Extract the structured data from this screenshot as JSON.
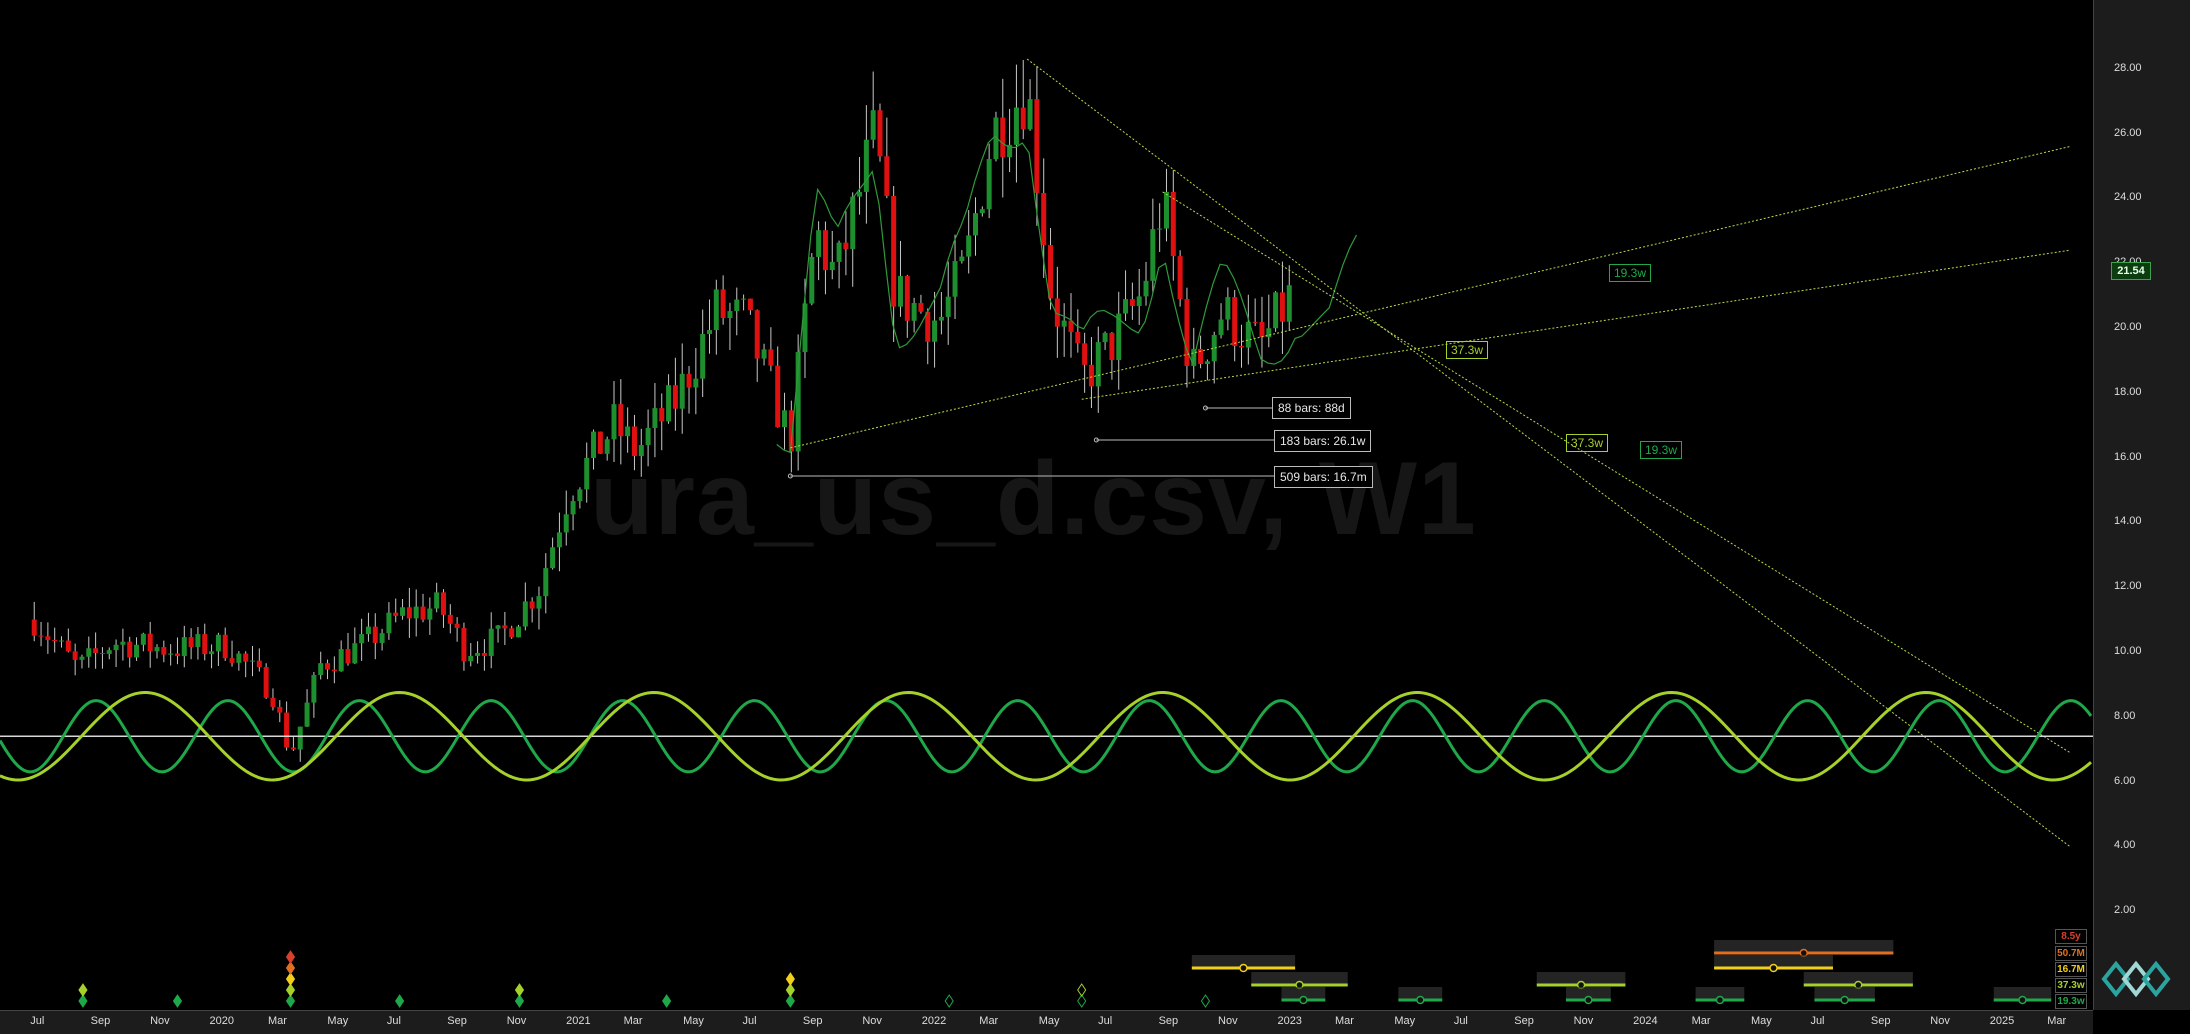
{
  "watermark": "ura_us_d.csv, W1",
  "price_scale": {
    "ticks": [
      "28.00",
      "26.00",
      "24.00",
      "22.00",
      "20.00",
      "18.00",
      "16.00",
      "14.00",
      "12.00",
      "10.00",
      "8.00",
      "6.00",
      "4.00",
      "2.00"
    ],
    "last_price": "21.54"
  },
  "time_scale": {
    "ticks": [
      "Jul",
      "Sep",
      "Nov",
      "2020",
      "Mar",
      "May",
      "Jul",
      "Sep",
      "Nov",
      "2021",
      "Mar",
      "May",
      "Jul",
      "Sep",
      "Nov",
      "2022",
      "Mar",
      "May",
      "Jul",
      "Sep",
      "Nov",
      "2023",
      "Mar",
      "May",
      "Jul",
      "Sep",
      "Nov",
      "2024",
      "Mar",
      "May",
      "Jul",
      "Sep",
      "Nov",
      "2025",
      "Mar"
    ]
  },
  "annotations": {
    "bars_labels": [
      "88 bars: 88d",
      "183 bars: 26.1w",
      "509 bars: 16.7m"
    ],
    "projection_labels": [
      "19.3w",
      "37.3w",
      "37.3w",
      "19.3w"
    ]
  },
  "cycle_tags": [
    "8.5y",
    "50.7M",
    "16.7M",
    "37.3w",
    "19.3w"
  ],
  "colors": {
    "up": "#1e8f2e",
    "down": "#e01010",
    "wave_fast": "#1fa84a",
    "wave_slow": "#a6d02a",
    "trend": "#9acd32",
    "midline": "#d8d8d8",
    "tag_red": "#d9402b",
    "tag_orange": "#e07020",
    "tag_yellow": "#f2d019",
    "tag_lime": "#a6d02a",
    "tag_green": "#1fa84a"
  },
  "chart_data": {
    "type": "candlestick",
    "timeframe": "weekly",
    "x_range": [
      "2019-06",
      "2025-03"
    ],
    "ylim": [
      0,
      30
    ],
    "price_path": [
      [
        "2019-07-01",
        11.0
      ],
      [
        "2019-08-15",
        9.5
      ],
      [
        "2019-09-20",
        10.3
      ],
      [
        "2019-11-15",
        10.1
      ],
      [
        "2020-01-15",
        10.2
      ],
      [
        "2020-03-01",
        8.8
      ],
      [
        "2020-03-20",
        6.8
      ],
      [
        "2020-04-20",
        9.6
      ],
      [
        "2020-06-01",
        10.2
      ],
      [
        "2020-07-15",
        11.2
      ],
      [
        "2020-08-20",
        11.4
      ],
      [
        "2020-09-15",
        10.1
      ],
      [
        "2020-10-20",
        10.4
      ],
      [
        "2020-11-30",
        12.0
      ],
      [
        "2020-12-31",
        15.0
      ],
      [
        "2021-02-15",
        17.0
      ],
      [
        "2021-03-10",
        16.2
      ],
      [
        "2021-04-20",
        17.8
      ],
      [
        "2021-05-31",
        20.5
      ],
      [
        "2021-06-30",
        20.2
      ],
      [
        "2021-08-15",
        16.5
      ],
      [
        "2021-09-10",
        23.0
      ],
      [
        "2021-10-01",
        21.5
      ],
      [
        "2021-11-10",
        26.0
      ],
      [
        "2021-12-01",
        21.0
      ],
      [
        "2022-01-15",
        20.2
      ],
      [
        "2022-02-10",
        21.8
      ],
      [
        "2022-03-10",
        26.0
      ],
      [
        "2022-04-15",
        27.5
      ],
      [
        "2022-05-10",
        21.0
      ],
      [
        "2022-06-10",
        18.4
      ],
      [
        "2022-07-10",
        19.5
      ],
      [
        "2022-08-10",
        21.0
      ],
      [
        "2022-09-01",
        24.0
      ],
      [
        "2022-10-01",
        18.6
      ],
      [
        "2022-11-01",
        20.5
      ],
      [
        "2022-12-10",
        19.4
      ],
      [
        "2023-01-15",
        21.2
      ]
    ],
    "projection_path": [
      [
        "2023-01-15",
        21.2
      ],
      [
        "2023-02-01",
        20.8
      ],
      [
        "2023-02-20",
        20.0
      ],
      [
        "2023-03-10",
        20.8
      ],
      [
        "2023-03-25",
        21.6
      ]
    ],
    "trendlines": [
      {
        "from": [
          "2021-08-15",
          16.3
        ],
        "to": [
          "2025-03-20",
          25.6
        ]
      },
      {
        "from": [
          "2022-06-10",
          17.8
        ],
        "to": [
          "2025-03-20",
          22.4
        ]
      },
      {
        "from": [
          "2022-04-15",
          28.3
        ],
        "to": [
          "2025-03-20",
          4.0
        ]
      },
      {
        "from": [
          "2022-09-01",
          24.2
        ],
        "to": [
          "2025-03-20",
          6.9
        ]
      }
    ],
    "measure_lines": [
      {
        "from": "2022-10-15",
        "to": "2023-01-15",
        "label": "88 bars: 88d"
      },
      {
        "from": "2022-06-25",
        "to": "2023-01-15",
        "label": "183 bars: 26.1w"
      },
      {
        "from": "2021-08-15",
        "to": "2023-01-15",
        "label": "509 bars: 16.7m"
      }
    ],
    "oscillator": {
      "midline": 7.4,
      "series": [
        {
          "name": "19.3w",
          "period_weeks": 19.3,
          "amplitude": 1.1
        },
        {
          "name": "37.3w",
          "period_weeks": 37.3,
          "amplitude": 1.35
        }
      ]
    },
    "cycle_markers": [
      {
        "date": "2019-08-20",
        "colors": [
          "tag_lime",
          "tag_green"
        ]
      },
      {
        "date": "2019-11-25",
        "colors": [
          "tag_green"
        ]
      },
      {
        "date": "2020-03-20",
        "colors": [
          "tag_red",
          "tag_orange",
          "tag_yellow",
          "tag_lime",
          "tag_green"
        ]
      },
      {
        "date": "2020-07-10",
        "colors": [
          "tag_green"
        ]
      },
      {
        "date": "2020-11-10",
        "colors": [
          "tag_lime",
          "tag_green"
        ]
      },
      {
        "date": "2021-04-10",
        "colors": [
          "tag_green"
        ]
      },
      {
        "date": "2021-08-15",
        "colors": [
          "tag_yellow",
          "tag_lime",
          "tag_green"
        ]
      },
      {
        "date": "2022-01-25",
        "colors": [
          "tag_green"
        ],
        "hollow": true
      },
      {
        "date": "2022-06-10",
        "colors": [
          "tag_lime",
          "tag_green"
        ],
        "hollow": true
      },
      {
        "date": "2022-10-15",
        "colors": [
          "tag_green"
        ],
        "hollow": true
      }
    ],
    "projection_windows": [
      {
        "from": "2022-12-01",
        "to": "2023-03-10",
        "color": "tag_lime"
      },
      {
        "from": "2023-01-01",
        "to": "2023-02-15",
        "color": "tag_green"
      },
      {
        "from": "2023-05-01",
        "to": "2023-06-15",
        "color": "tag_green"
      },
      {
        "from": "2023-09-20",
        "to": "2023-12-20",
        "color": "tag_lime"
      },
      {
        "from": "2023-10-20",
        "to": "2023-12-05",
        "color": "tag_green"
      },
      {
        "from": "2024-03-01",
        "to": "2024-04-20",
        "color": "tag_green"
      },
      {
        "from": "2024-03-20",
        "to": "2024-09-20",
        "color": "tag_orange"
      },
      {
        "from": "2024-03-20",
        "to": "2024-07-20",
        "color": "tag_yellow"
      },
      {
        "from": "2024-06-20",
        "to": "2024-10-10",
        "color": "tag_lime"
      },
      {
        "from": "2024-07-01",
        "to": "2024-09-01",
        "color": "tag_green"
      },
      {
        "from": "2025-01-01",
        "to": "2025-03-01",
        "color": "tag_green"
      },
      {
        "from": "2022-10-01",
        "to": "2023-01-15",
        "color": "tag_yellow"
      }
    ]
  }
}
